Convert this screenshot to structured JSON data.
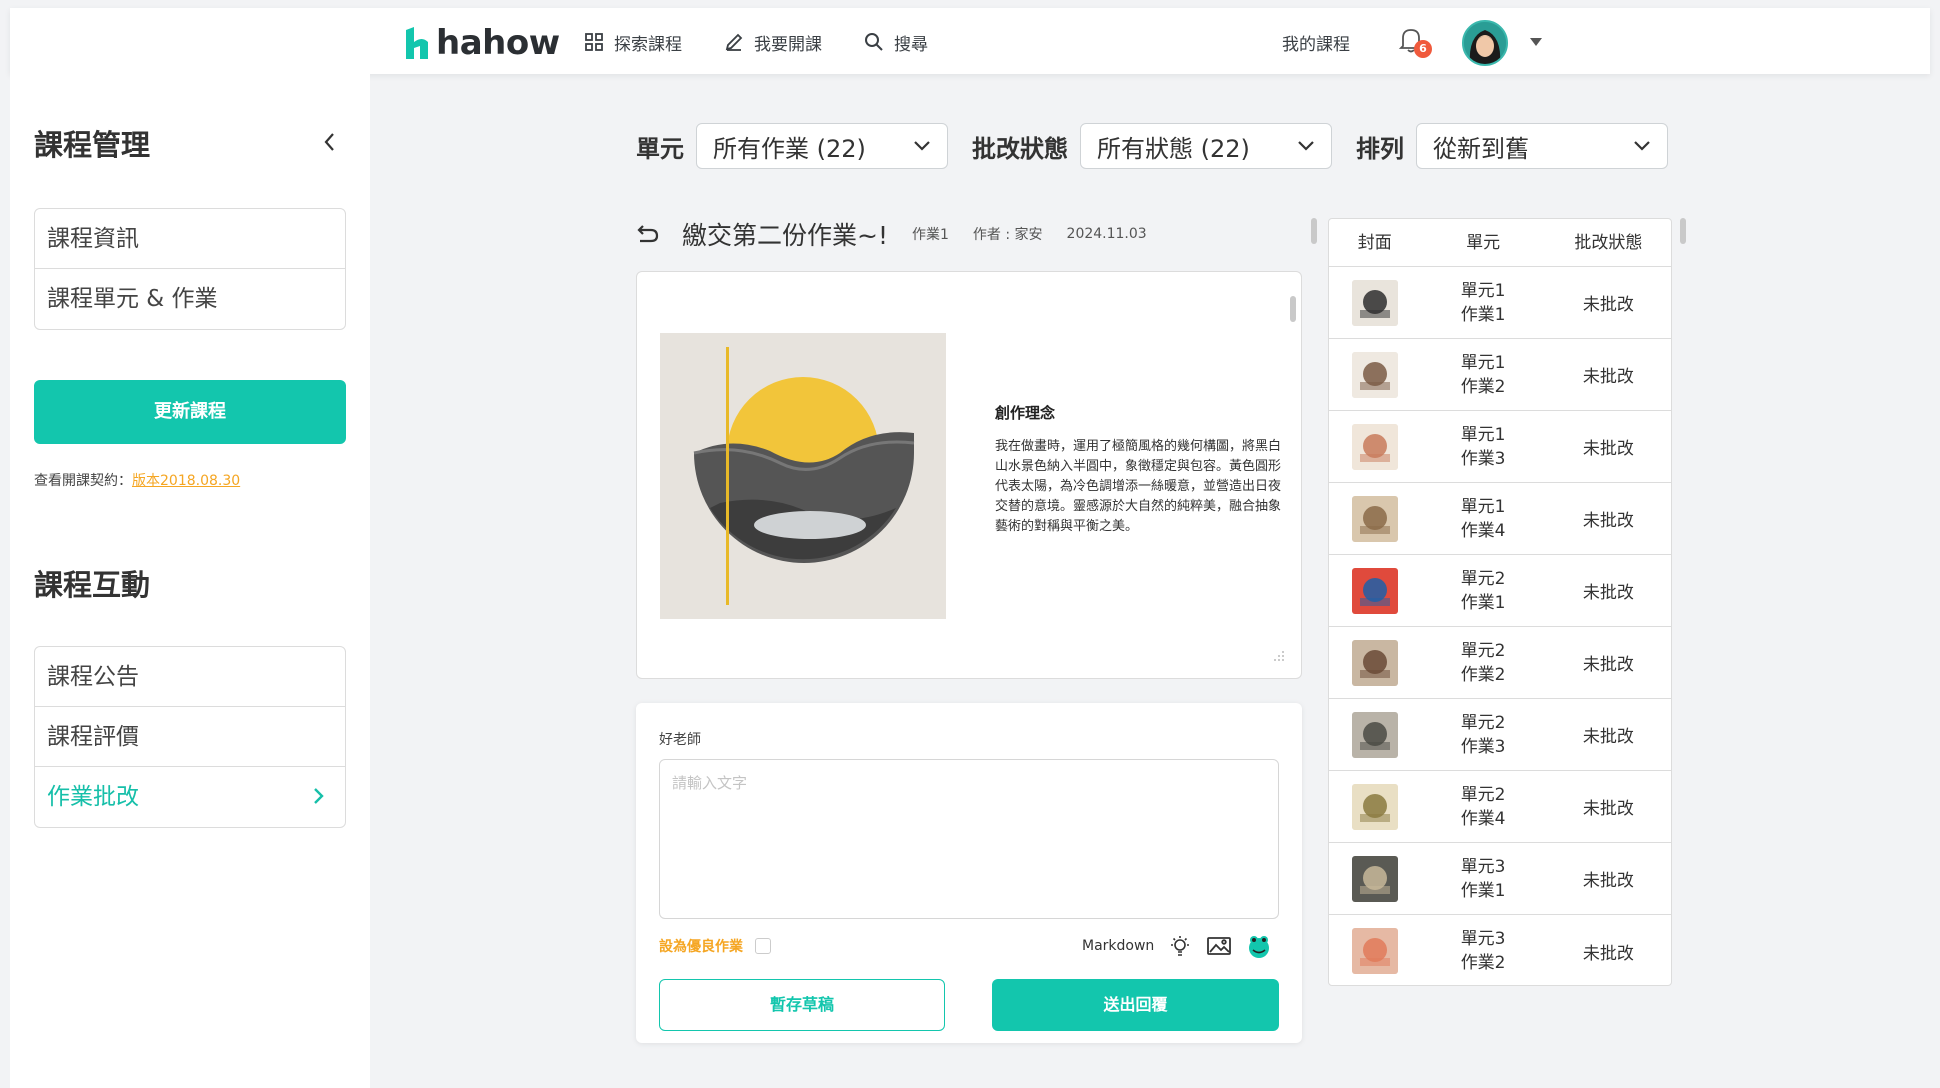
{
  "brand": {
    "logo_text": "hahow",
    "accent": "#13c6ad"
  },
  "nav": {
    "explore": "探索課程",
    "teach": "我要開課",
    "search": "搜尋",
    "my_courses": "我的課程",
    "notification_count": "6"
  },
  "sidebar": {
    "manage_title": "課程管理",
    "manage_items": [
      {
        "label": "課程資訊"
      },
      {
        "label": "課程單元 & 作業"
      }
    ],
    "update_button": "更新課程",
    "contract_prefix": "查看開課契約：",
    "contract_link": "版本2018.08.30",
    "interact_title": "課程互動",
    "interact_items": [
      {
        "label": "課程公告"
      },
      {
        "label": "課程評價"
      },
      {
        "label": "作業批改"
      }
    ]
  },
  "filters": {
    "unit_label": "單元",
    "unit_value": "所有作業 (22)",
    "status_label": "批改狀態",
    "status_value": "所有狀態 (22)",
    "sort_label": "排列",
    "sort_value": "從新到舊"
  },
  "homework": {
    "title": "繳交第二份作業~!",
    "assignment": "作業1",
    "author": "作者 : 家安",
    "date": "2024.11.03",
    "concept_heading": "創作理念",
    "concept_text": "我在做畫時，運用了極簡風格的幾何構圖，將黑白山水景色納入半圓中，象徵穩定與包容。黃色圓形代表太陽，為冷色調增添一絲暖意，並營造出日夜交替的意境。靈感源於大自然的純粹美，融合抽象藝術的對稱與平衡之美。"
  },
  "reply": {
    "teacher_name": "好老師",
    "placeholder": "請輸入文字",
    "mark_excellent": "設為優良作業",
    "markdown_label": "Markdown",
    "draft_button": "暫存草稿",
    "send_button": "送出回覆"
  },
  "table": {
    "headers": [
      "封面",
      "單元",
      "批改狀態"
    ],
    "rows": [
      {
        "unit": "單元1",
        "work": "作業1",
        "status": "未批改"
      },
      {
        "unit": "單元1",
        "work": "作業2",
        "status": "未批改"
      },
      {
        "unit": "單元1",
        "work": "作業3",
        "status": "未批改"
      },
      {
        "unit": "單元1",
        "work": "作業4",
        "status": "未批改"
      },
      {
        "unit": "單元2",
        "work": "作業1",
        "status": "未批改"
      },
      {
        "unit": "單元2",
        "work": "作業2",
        "status": "未批改"
      },
      {
        "unit": "單元2",
        "work": "作業3",
        "status": "未批改"
      },
      {
        "unit": "單元2",
        "work": "作業4",
        "status": "未批改"
      },
      {
        "unit": "單元3",
        "work": "作業1",
        "status": "未批改"
      },
      {
        "unit": "單元3",
        "work": "作業2",
        "status": "未批改"
      }
    ]
  }
}
